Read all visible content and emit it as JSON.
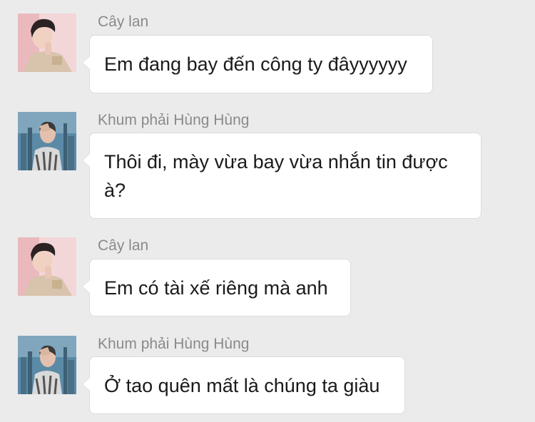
{
  "messages": [
    {
      "sender": "Cây lan",
      "avatar": "pink-portrait-avatar",
      "text": "Em đang bay đến công ty đâyyyyyy"
    },
    {
      "sender": "Khum phải Hùng Hùng",
      "avatar": "city-portrait-avatar",
      "text": "Thôi đi, mày vừa bay vừa nhắn tin được à?"
    },
    {
      "sender": "Cây lan",
      "avatar": "pink-portrait-avatar",
      "text": "Em có tài xế riêng mà anh"
    },
    {
      "sender": "Khum phải Hùng Hùng",
      "avatar": "city-portrait-avatar",
      "text": "Ở tao quên mất là chúng ta giàu"
    }
  ],
  "colors": {
    "background": "#ebebeb",
    "bubble": "#ffffff",
    "sender_name": "#8a8a8a",
    "message_text": "#1a1a1a"
  }
}
